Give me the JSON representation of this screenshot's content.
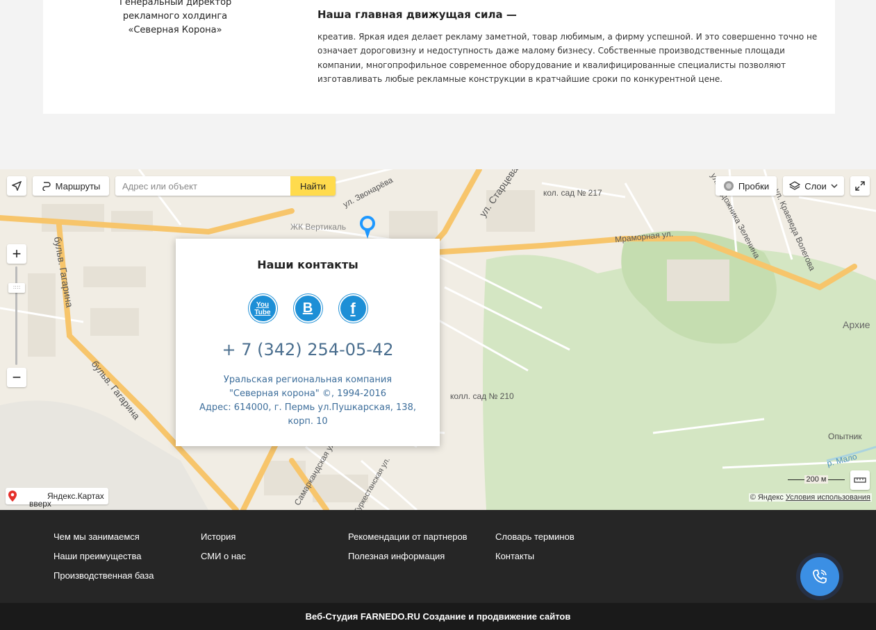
{
  "about": {
    "director_lines": [
      "Генеральный директор",
      "рекламного холдинга",
      "«Северная Корона»"
    ],
    "title": "Наша главная движущая сила —",
    "text": "креатив. Яркая идея делает рекламу заметной, товар любимым, а фирму успешной. И это совершенно точно не означает дороговизну и недоступность даже малому бизнесу. Собственные производственные площади компании, многопрофильное современное оборудование и квалифицированные специалисты позволяют изготавливать любые рекламные конструкции в кратчайшие сроки по конкурентной цене."
  },
  "map": {
    "routes_label": "Маршруты",
    "search_placeholder": "Адрес или объект",
    "search_button": "Найти",
    "traffic_label": "Пробки",
    "layers_label": "Слои",
    "zoom_in": "+",
    "zoom_out": "−",
    "logo_text": "Яндекс.Картах",
    "to_top": "вверх",
    "copyright": "© Яндекс",
    "terms": "Условия использования",
    "scale": "200 м",
    "labels": {
      "zvonareva": "ул. Звонарёва",
      "startsev": "ул. Старцева",
      "sad217": "кол. сад № 217",
      "vertical": "ЖК Вертикаль",
      "mramornaya": "Мраморная ул.",
      "zelenina": "ул. Художника Зеленина",
      "volegova": "ул. Краеведа Волегова",
      "gagarina1": "бульв. Гагарина",
      "gagarina2": "бульв. Гагарина",
      "sad210": "колл. сад № 210",
      "samarkand": "Самаркандская ул.",
      "turkestan": "Туркестанская ул.",
      "opytnik": "Опытник",
      "molot": "р. Мало",
      "arkh": "Архие"
    },
    "icons": {
      "locate": "locate-arrow-icon",
      "routes": "routes-icon",
      "traffic": "traffic-icon",
      "layers": "layers-icon",
      "fullscreen": "fullscreen-icon",
      "ruler": "ruler-icon",
      "pin": "map-pin-icon"
    },
    "colors": {
      "road": "#f7c56b",
      "park": "#d4e6c3",
      "background": "#f1ede4",
      "water": "#aad3df"
    }
  },
  "contacts": {
    "title": "Наши контакты",
    "socials": [
      {
        "name": "youtube",
        "label": "You Tube"
      },
      {
        "name": "vk",
        "label": "B"
      },
      {
        "name": "facebook",
        "label": "f"
      }
    ],
    "phone": "+ 7 (342) 254-05-42",
    "company_line1": "Уральская региональная компания",
    "company_line2": "\"Северная корона\" ©, 1994-2016",
    "address": "Адрес: 614000, г. Пермь ул.Пушкарская, 138, корп. 10",
    "accent_color": "#1d8fd6"
  },
  "footer": {
    "col1": [
      "Чем мы занимаемся",
      "Наши преимущества",
      "Производственная база"
    ],
    "col2": [
      "История",
      "СМИ о нас"
    ],
    "col3": [
      "Рекомендации от партнеров",
      "Полезная информация"
    ],
    "col4": [
      "Словарь терминов",
      "Контакты"
    ],
    "studio": "Веб-Студия FARNEDO.RU Создание и продвижение сайтов",
    "call_icon": "phone-call-icon"
  }
}
